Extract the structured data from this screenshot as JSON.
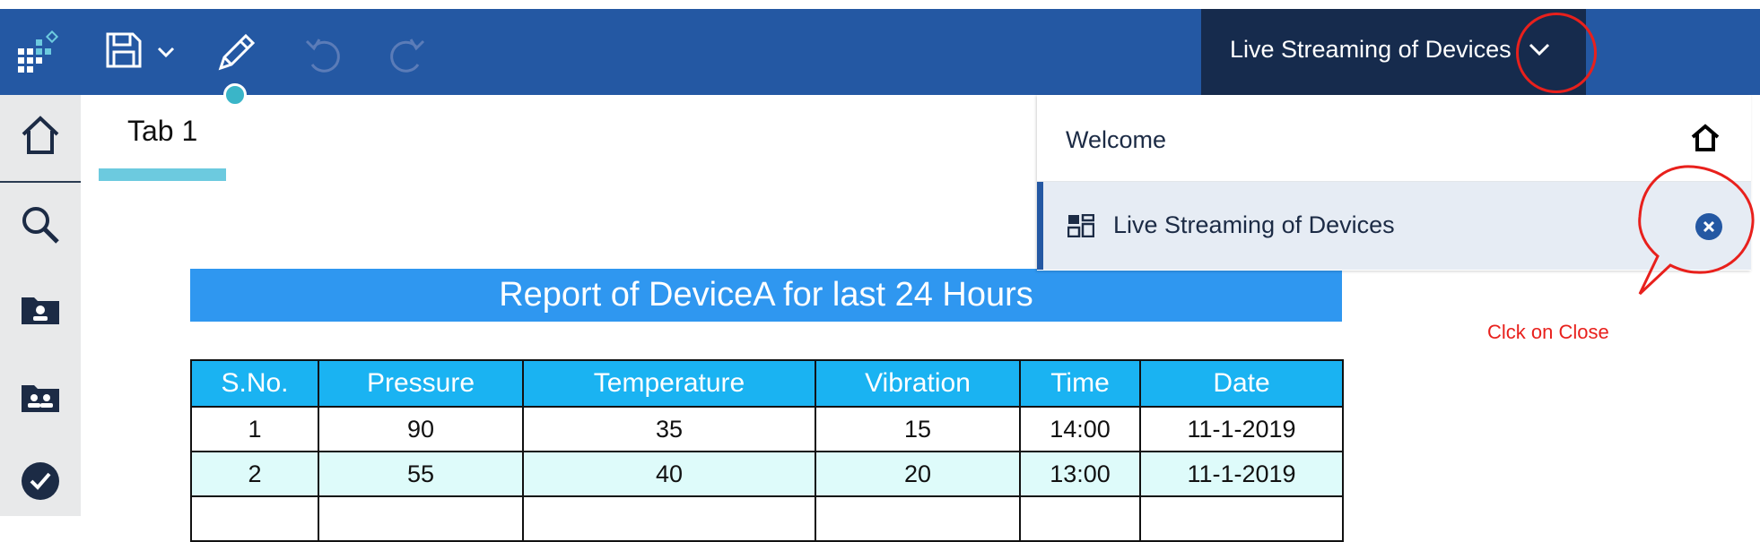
{
  "toolbar": {
    "icons": [
      "app-grid-icon",
      "save-icon",
      "chevron-down-icon",
      "pencil-icon",
      "undo-icon",
      "redo-icon"
    ]
  },
  "dashboard_tab": {
    "title": "Live Streaming of Devices"
  },
  "sidebar": {
    "items": [
      "home-icon",
      "search-icon",
      "my-content-icon",
      "team-content-icon",
      "check-icon"
    ]
  },
  "canvas": {
    "tab_label": "Tab 1",
    "report_title": "Report of DeviceA for last 24 Hours"
  },
  "table": {
    "headers": [
      "S.No.",
      "Pressure",
      "Temperature",
      "Vibration",
      "Time",
      "Date"
    ],
    "rows": [
      [
        "1",
        "90",
        "35",
        "15",
        "14:00",
        "11-1-2019"
      ],
      [
        "2",
        "55",
        "40",
        "20",
        "13:00",
        "11-1-2019"
      ]
    ]
  },
  "dropdown": {
    "items": [
      {
        "label": "Welcome",
        "icon": "home-icon"
      },
      {
        "label": "Live Streaming of Devices",
        "icon": "dashboard-icon",
        "action": "close-icon"
      }
    ]
  },
  "annotation": {
    "text": "Clck on Close"
  },
  "colors": {
    "topbar": "#2458a3",
    "active_tab": "#162b4d",
    "report_title_bg": "#2f97f0",
    "table_header_bg": "#1ab3f2",
    "annotation": "#e8201c"
  }
}
